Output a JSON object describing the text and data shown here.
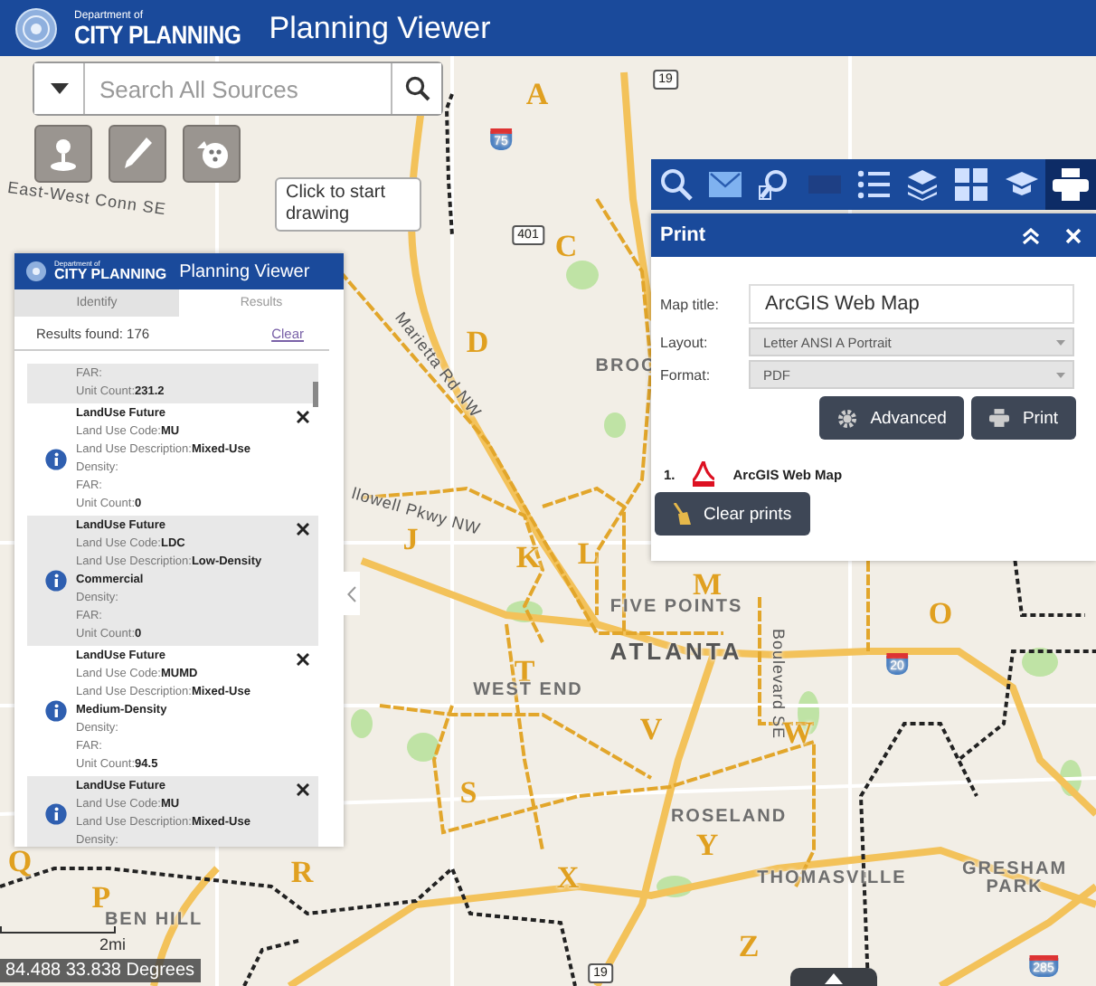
{
  "header": {
    "department": "Department of",
    "agency": "CITY PLANNING",
    "app_title": "Planning Viewer"
  },
  "search": {
    "placeholder": "Search All Sources"
  },
  "draw_tools": [
    {
      "kind": "pin"
    },
    {
      "kind": "pencil"
    },
    {
      "kind": "palette"
    }
  ],
  "tooltip": "Click to start drawing",
  "results_panel": {
    "department": "Department of",
    "agency": "CITY PLANNING",
    "title": "Planning Viewer",
    "tabs": [
      {
        "label": "Identify",
        "selected": false
      },
      {
        "label": "Results",
        "selected": true
      }
    ],
    "count": "Results found: 176",
    "clear": "Clear",
    "results": [
      {
        "fields": [
          {
            "label": "FAR:"
          },
          {
            "label": "Unit Count:",
            "value": "231.2"
          }
        ]
      },
      {
        "title": "LandUse Future",
        "fields": [
          {
            "label": "Land Use Code:",
            "value": "MU"
          },
          {
            "label": "Land Use Description:",
            "value": "Mixed-Use"
          },
          {
            "label": "Density:"
          },
          {
            "label": "FAR:"
          },
          {
            "label": "Unit Count:",
            "value": "0"
          }
        ]
      },
      {
        "title": "LandUse Future",
        "fields": [
          {
            "label": "Land Use Code:",
            "value": "LDC"
          },
          {
            "label": "Land Use Description:",
            "value": "Low-Density Commercial"
          },
          {
            "label": "Density:"
          },
          {
            "label": "FAR:"
          },
          {
            "label": "Unit Count:",
            "value": "0"
          }
        ]
      },
      {
        "title": "LandUse Future",
        "fields": [
          {
            "label": "Land Use Code:",
            "value": "MUMD"
          },
          {
            "label": "Land Use Description:",
            "value": "Mixed-Use Medium-Density"
          },
          {
            "label": "Density:"
          },
          {
            "label": "FAR:"
          },
          {
            "label": "Unit Count:",
            "value": "94.5"
          }
        ]
      },
      {
        "title": "LandUse Future",
        "fields": [
          {
            "label": "Land Use Code:",
            "value": "MU"
          },
          {
            "label": "Land Use Description:",
            "value": "Mixed-Use"
          },
          {
            "label": "Density:"
          }
        ]
      }
    ]
  },
  "toolbar": [
    {
      "kind": "search",
      "selected": false
    },
    {
      "kind": "mail",
      "selected": false
    },
    {
      "kind": "doc-search",
      "selected": false
    },
    {
      "kind": "blank",
      "selected": false
    },
    {
      "kind": "list",
      "selected": false
    },
    {
      "kind": "layers",
      "selected": false
    },
    {
      "kind": "grid",
      "selected": false
    },
    {
      "kind": "cap",
      "selected": false
    },
    {
      "kind": "printer",
      "selected": true
    }
  ],
  "print_panel": {
    "title": "Print",
    "fields": [
      {
        "label": "Map title:",
        "value": "ArcGIS Web Map",
        "kind": "text"
      },
      {
        "label": "Layout:",
        "value": "Letter ANSI A Portrait",
        "kind": "select"
      },
      {
        "label": "Format:",
        "value": "PDF",
        "kind": "select"
      }
    ],
    "buttons": [
      {
        "label": "Advanced",
        "kind": "gear"
      },
      {
        "label": "Print",
        "kind": "printer"
      }
    ],
    "outputs": [
      {
        "number": "1.",
        "name": "ArcGIS Web Map"
      }
    ],
    "clear_button": "Clear prints"
  },
  "map": {
    "labels": [
      {
        "text": "19",
        "kind": "us-route"
      },
      {
        "text": "A",
        "kind": "district"
      },
      {
        "text": "75",
        "kind": "interstate"
      },
      {
        "text": "East-West Conn SE",
        "kind": "road"
      },
      {
        "text": "401",
        "kind": "route"
      },
      {
        "text": "C",
        "kind": "district"
      },
      {
        "text": "BROC",
        "kind": "place"
      },
      {
        "text": "Marietta Rd NW",
        "kind": "road"
      },
      {
        "text": "D",
        "kind": "district"
      },
      {
        "text": "llowell Pkwy NW",
        "kind": "road"
      },
      {
        "text": "J",
        "kind": "district"
      },
      {
        "text": "K",
        "kind": "district"
      },
      {
        "text": "L",
        "kind": "district"
      },
      {
        "text": "M",
        "kind": "district"
      },
      {
        "text": "FIVE POINTS",
        "kind": "place"
      },
      {
        "text": "O",
        "kind": "district"
      },
      {
        "text": "ATLANTA",
        "kind": "city"
      },
      {
        "text": "T",
        "kind": "district"
      },
      {
        "text": "WEST END",
        "kind": "place"
      },
      {
        "text": "20",
        "kind": "interstate"
      },
      {
        "text": "Boulevard SE",
        "kind": "road"
      },
      {
        "text": "V",
        "kind": "district"
      },
      {
        "text": "W",
        "kind": "district"
      },
      {
        "text": "S",
        "kind": "district"
      },
      {
        "text": "ROSELAND",
        "kind": "place"
      },
      {
        "text": "Y",
        "kind": "district"
      },
      {
        "text": "Q",
        "kind": "district"
      },
      {
        "text": "R",
        "kind": "district"
      },
      {
        "text": "X",
        "kind": "district"
      },
      {
        "text": "THOMASVILLE",
        "kind": "place"
      },
      {
        "text": "GRESHAM PARK",
        "kind": "place"
      },
      {
        "text": "P",
        "kind": "district"
      },
      {
        "text": "BEN HILL",
        "kind": "place"
      },
      {
        "text": "Z",
        "kind": "district"
      },
      {
        "text": "19",
        "kind": "us-route"
      },
      {
        "text": "285",
        "kind": "interstate"
      }
    ],
    "scale": "2mi",
    "coordinates": "84.488 33.838 Degrees"
  }
}
